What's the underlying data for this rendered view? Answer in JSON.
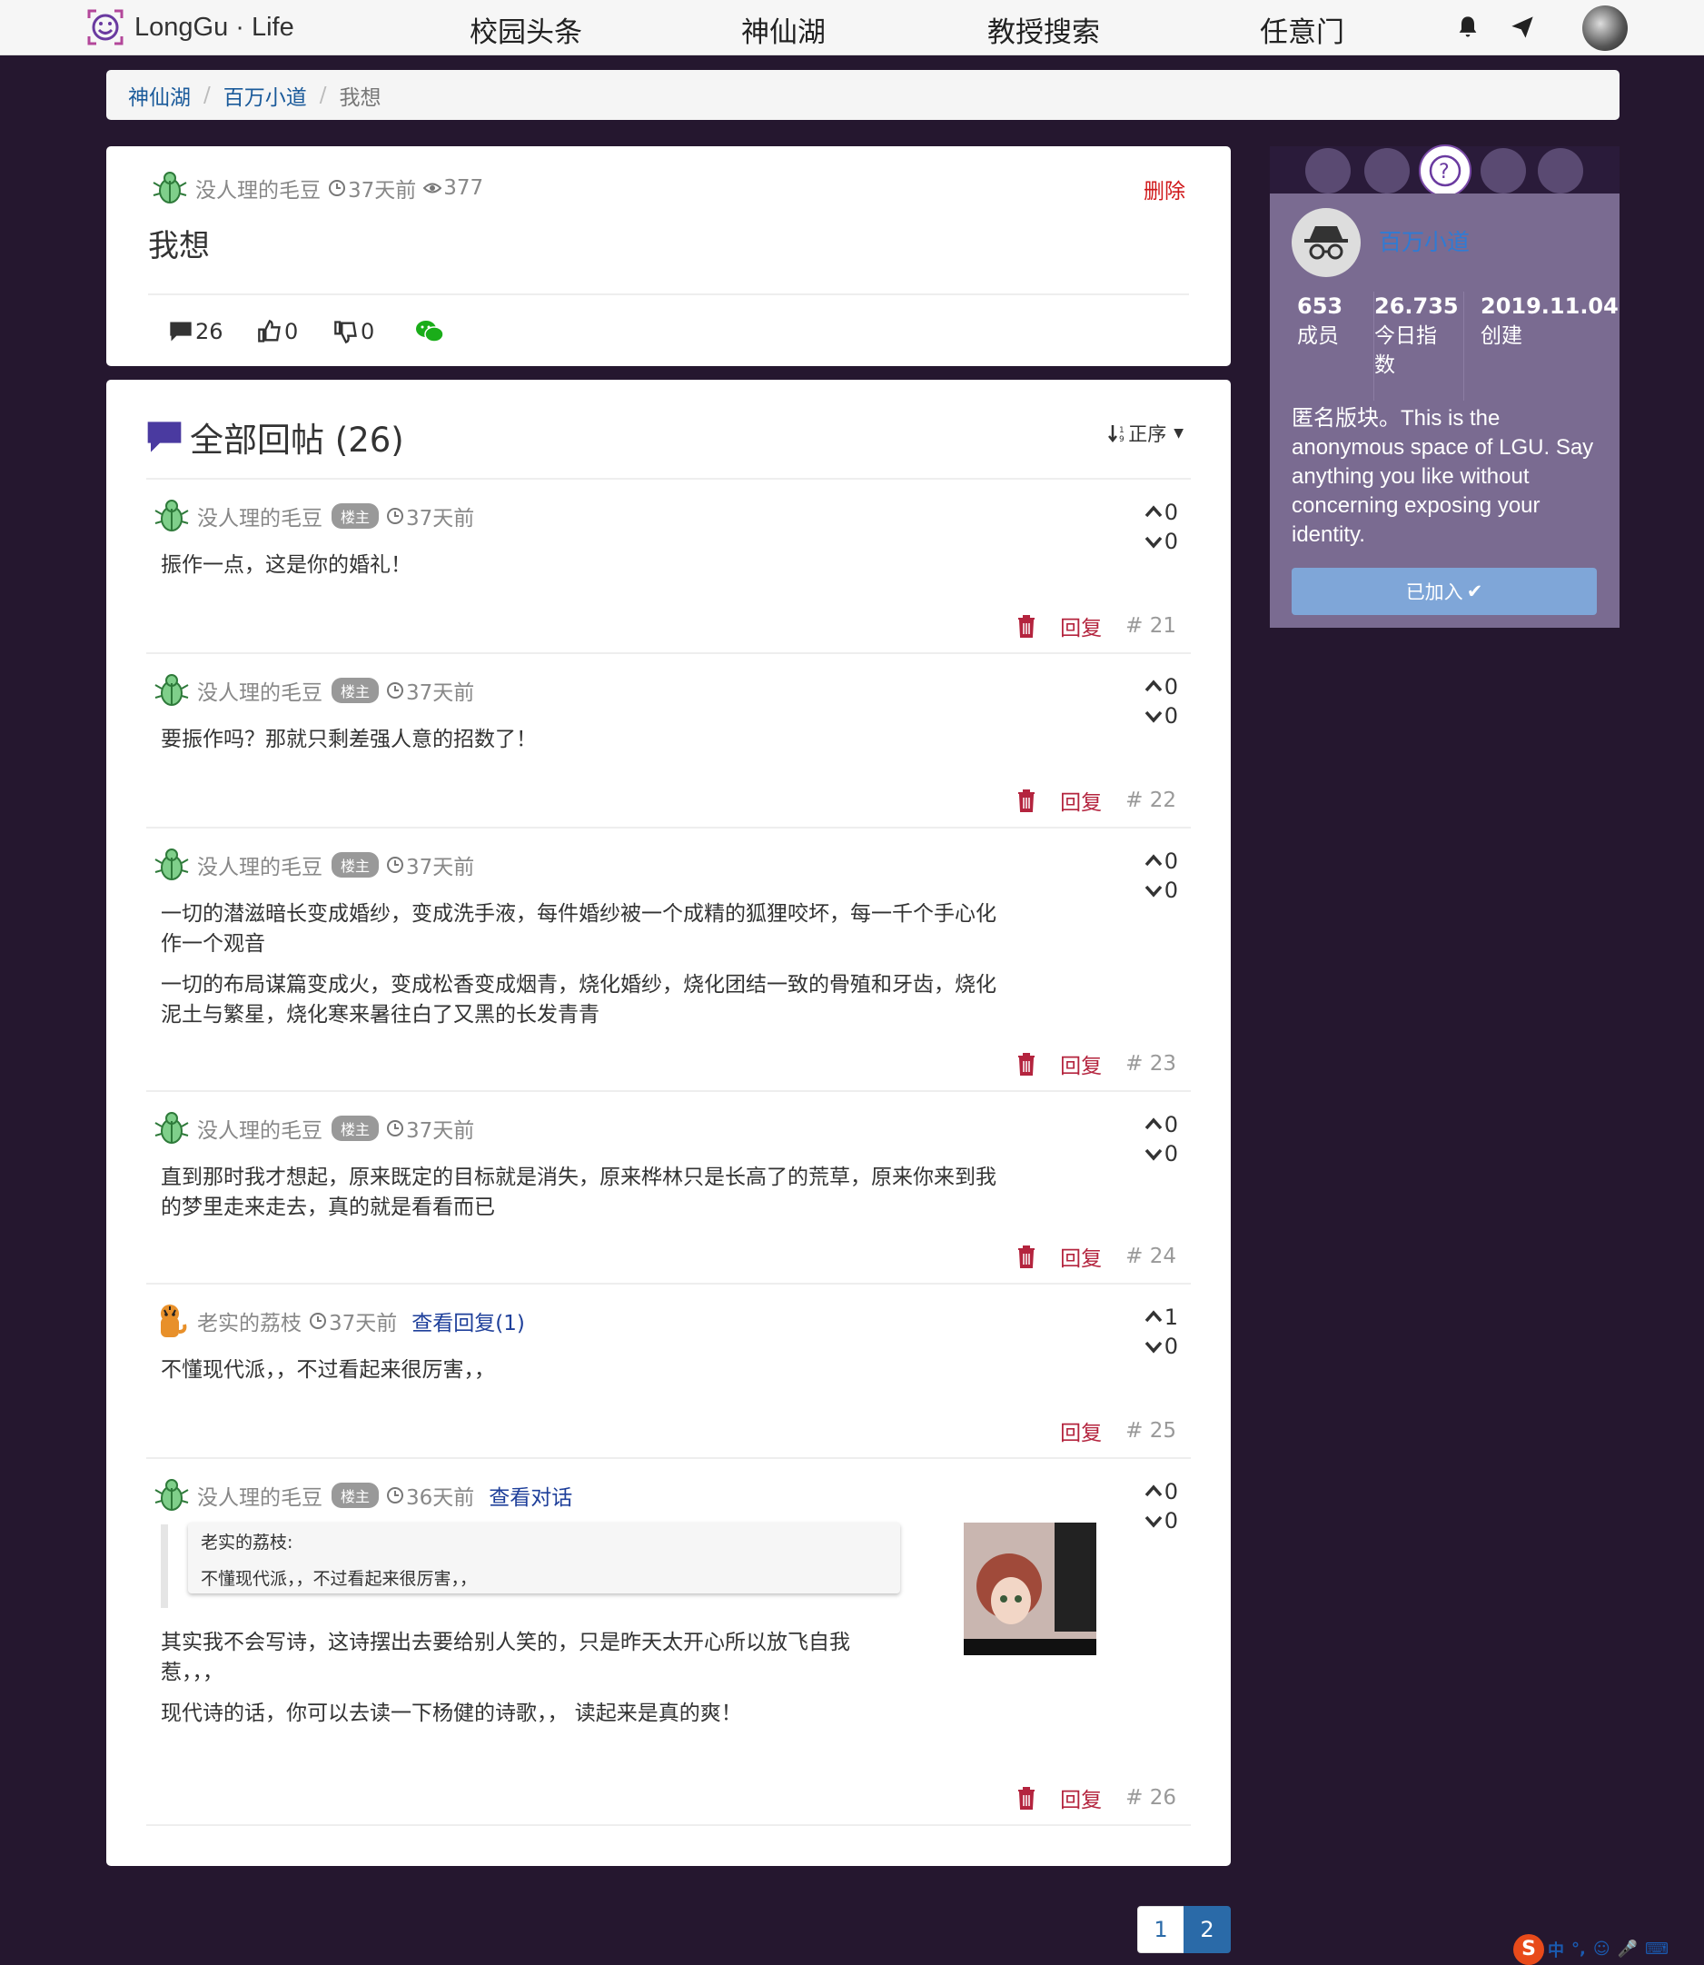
{
  "nav": {
    "brand": "LongGu · Life",
    "links": [
      "校园头条",
      "神仙湖",
      "教授搜索",
      "任意门"
    ]
  },
  "breadcrumb": {
    "items": [
      "神仙湖",
      "百万小道"
    ],
    "current": "我想"
  },
  "post": {
    "author": "没人理的毛豆",
    "time": "37天前",
    "views": "377",
    "title": "我想",
    "delete_label": "删除",
    "comments": "26",
    "likes": "0",
    "dislikes": "0"
  },
  "replies": {
    "title": "全部回帖 (26)",
    "sort_label": "正序",
    "op_badge": "楼主",
    "reply_label": "回复",
    "items": [
      {
        "author": "没人理的毛豆",
        "op": true,
        "time": "37天前",
        "text": [
          "振作一点，这是你的婚礼！"
        ],
        "up": "0",
        "down": "0",
        "floor": "# 21"
      },
      {
        "author": "没人理的毛豆",
        "op": true,
        "time": "37天前",
        "text": [
          "要振作吗？那就只剩差强人意的招数了！"
        ],
        "up": "0",
        "down": "0",
        "floor": "# 22"
      },
      {
        "author": "没人理的毛豆",
        "op": true,
        "time": "37天前",
        "text": [
          "一切的潜滋暗长变成婚纱，变成洗手液，每件婚纱被一个成精的狐狸咬坏，每一千个手心化作一个观音",
          "一切的布局谋篇变成火，变成松香变成烟青，烧化婚纱，烧化团结一致的骨殖和牙齿，烧化泥土与繁星，烧化寒来暑往白了又黑的长发青青"
        ],
        "up": "0",
        "down": "0",
        "floor": "# 23"
      },
      {
        "author": "没人理的毛豆",
        "op": true,
        "time": "37天前",
        "text": [
          "直到那时我才想起，原来既定的目标就是消失，原来桦林只是长高了的荒草，原来你来到我的梦里走来走去，真的就是看看而已"
        ],
        "up": "0",
        "down": "0",
        "floor": "# 24"
      },
      {
        "author": "老实的荔枝",
        "op": false,
        "time": "37天前",
        "extra_link": "查看回复(1)",
        "text": [
          "不懂现代派，，不过看起来很厉害，，"
        ],
        "up": "1",
        "down": "0",
        "floor": "# 25"
      },
      {
        "author": "没人理的毛豆",
        "op": true,
        "time": "36天前",
        "extra_link": "查看对话",
        "quote_author": "老实的荔枝:",
        "quote_text": "不懂现代派，，不过看起来很厉害，，",
        "text": [
          "其实我不会写诗，这诗摆出去要给别人笑的，只是昨天太开心所以放飞自我惹，，，",
          "现代诗的话，你可以去读一下杨健的诗歌，， 读起来是真的爽！"
        ],
        "up": "0",
        "down": "0",
        "floor": "# 26"
      }
    ]
  },
  "pagination": [
    "1",
    "2"
  ],
  "sidebar": {
    "board_name": "百万小道",
    "members": "653",
    "members_label": "成员",
    "index": "26.735",
    "index_label": "今日指数",
    "created": "2019.11.04",
    "created_label": "创建",
    "description": "匿名版块。This is the anonymous space of LGU. Say anything you like without concerning exposing your identity.",
    "joined_label": "已加入"
  },
  "ime": {
    "label": "中"
  },
  "colors": {
    "page_bg": "#25172f",
    "accent_red": "#d0191b",
    "sidebar_bg": "#7a6b91",
    "link_blue": "#1e3f9a"
  }
}
